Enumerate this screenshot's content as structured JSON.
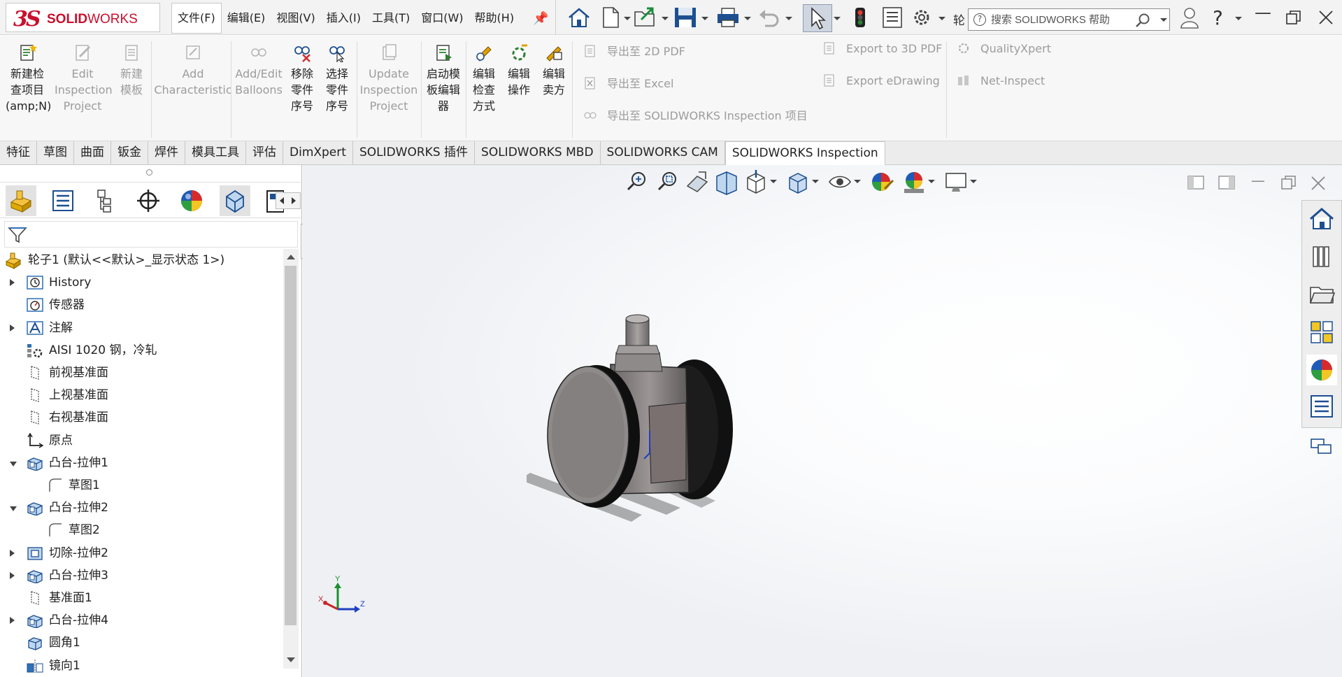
{
  "app": {
    "brand_ds": "3S",
    "brand_name_bold": "SOLID",
    "brand_name_light": "WORKS"
  },
  "menu": {
    "items": [
      "文件(F)",
      "编辑(E)",
      "视图(V)",
      "插入(I)",
      "工具(T)",
      "窗口(W)",
      "帮助(H)"
    ]
  },
  "toolbar": {
    "icons": [
      "home-icon",
      "new-document-icon",
      "open-icon",
      "save-icon",
      "print-icon",
      "undo-icon",
      "select-icon",
      "rebuild-icon",
      "file-properties-icon",
      "options-icon"
    ],
    "partial_label": "轮"
  },
  "search": {
    "placeholder": "搜索 SOLIDWORKS 帮助"
  },
  "command_manager": {
    "buttons": [
      {
        "label": "新建检\n查项目\n(amp;N)",
        "enabled": true,
        "icon": "new-inspection-icon"
      },
      {
        "label": "Edit\nInspection\nProject",
        "enabled": false,
        "icon": "edit-project-icon"
      },
      {
        "label": "新建\n模板",
        "enabled": false,
        "icon": "new-template-icon"
      },
      {
        "label": "Add\nCharacteristic",
        "enabled": false,
        "icon": "add-characteristic-icon"
      },
      {
        "label": "Add/Edit\nBalloons",
        "enabled": false,
        "icon": "balloons-icon"
      },
      {
        "label": "移除\n零件\n序号",
        "enabled": true,
        "icon": "remove-balloon-icon"
      },
      {
        "label": "选择\n零件\n序号",
        "enabled": true,
        "icon": "select-balloon-icon"
      },
      {
        "label": "Update\nInspection\nProject",
        "enabled": false,
        "icon": "update-project-icon"
      },
      {
        "label": "启动模\n板编辑\n器",
        "enabled": true,
        "icon": "template-editor-icon"
      },
      {
        "label": "编辑\n检查\n方式",
        "enabled": true,
        "icon": "edit-method-icon"
      },
      {
        "label": "编辑\n操作",
        "enabled": true,
        "icon": "edit-operation-icon"
      },
      {
        "label": "编辑\n卖方",
        "enabled": true,
        "icon": "edit-vendor-icon"
      }
    ],
    "export_items": [
      {
        "label": "导出至 2D PDF",
        "enabled": false
      },
      {
        "label": "导出至 Excel",
        "enabled": false
      },
      {
        "label": "导出至 SOLIDWORKS Inspection 项目",
        "enabled": false
      },
      {
        "label": "Export to 3D PDF",
        "enabled": false
      },
      {
        "label": "Export eDrawing",
        "enabled": false
      },
      {
        "label": "QualityXpert",
        "enabled": false
      },
      {
        "label": "Net-Inspect",
        "enabled": false
      }
    ]
  },
  "tabs": [
    "特征",
    "草图",
    "曲面",
    "钣金",
    "焊件",
    "模具工具",
    "评估",
    "DimXpert",
    "SOLIDWORKS 插件",
    "SOLIDWORKS MBD",
    "SOLIDWORKS CAM",
    "SOLIDWORKS Inspection"
  ],
  "active_tab": "SOLIDWORKS Inspection",
  "feature_tree": {
    "root": "轮子1  (默认<<默认>_显示状态 1>)",
    "items": [
      {
        "label": "History",
        "expander": "closed",
        "icon": "history-icon",
        "indent": 0
      },
      {
        "label": "传感器",
        "expander": "none",
        "icon": "sensor-icon",
        "indent": 0
      },
      {
        "label": "注解",
        "expander": "closed",
        "icon": "annotation-icon",
        "indent": 0
      },
      {
        "label": "AISI 1020 钢，冷轧",
        "expander": "none",
        "icon": "material-icon",
        "indent": 0
      },
      {
        "label": "前视基准面",
        "expander": "none",
        "icon": "plane-icon",
        "indent": 0
      },
      {
        "label": "上视基准面",
        "expander": "none",
        "icon": "plane-icon",
        "indent": 0
      },
      {
        "label": "右视基准面",
        "expander": "none",
        "icon": "plane-icon",
        "indent": 0
      },
      {
        "label": "原点",
        "expander": "none",
        "icon": "origin-icon",
        "indent": 0
      },
      {
        "label": "凸台-拉伸1",
        "expander": "open",
        "icon": "extrude-icon",
        "indent": 0
      },
      {
        "label": "草图1",
        "expander": "none",
        "icon": "sketch-icon",
        "indent": 1
      },
      {
        "label": "凸台-拉伸2",
        "expander": "open",
        "icon": "extrude-icon",
        "indent": 0
      },
      {
        "label": "草图2",
        "expander": "none",
        "icon": "sketch-icon",
        "indent": 1
      },
      {
        "label": "切除-拉伸2",
        "expander": "closed",
        "icon": "cut-extrude-icon",
        "indent": 0
      },
      {
        "label": "凸台-拉伸3",
        "expander": "closed",
        "icon": "extrude-icon",
        "indent": 0
      },
      {
        "label": "基准面1",
        "expander": "none",
        "icon": "plane-icon",
        "indent": 0
      },
      {
        "label": "凸台-拉伸4",
        "expander": "closed",
        "icon": "extrude-icon",
        "indent": 0
      },
      {
        "label": "圆角1",
        "expander": "none",
        "icon": "fillet-icon",
        "indent": 0
      },
      {
        "label": "镜向1",
        "expander": "none",
        "icon": "mirror-icon",
        "indent": 0
      }
    ]
  },
  "view_triad": {
    "x": "X",
    "y": "Y",
    "z": "Z"
  },
  "colors": {
    "brand_red": "#c8102e",
    "tree_icon_blue": "#2f6fb5",
    "wheel_gray": "#8e8a8a",
    "wheel_black": "#111111"
  }
}
